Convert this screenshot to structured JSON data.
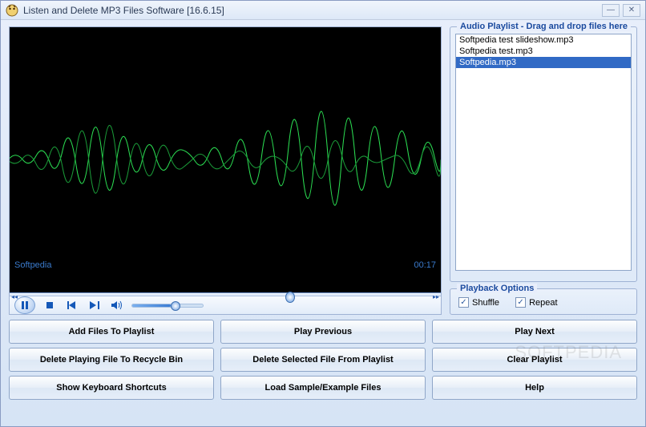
{
  "window": {
    "title": "Listen and Delete MP3 Files Software [16.6.15]"
  },
  "player": {
    "sourceLabel": "Softpedia",
    "timeLabel": "00:17",
    "seekPercent": 64
  },
  "playlist": {
    "groupLabel": "Audio Playlist - Drag and drop files here",
    "items": [
      {
        "name": "Softpedia test slideshow.mp3",
        "selected": false
      },
      {
        "name": "Softpedia test.mp3",
        "selected": false
      },
      {
        "name": "Softpedia.mp3",
        "selected": true
      }
    ]
  },
  "playback": {
    "groupLabel": "Playback Options",
    "shuffle": {
      "label": "Shuffle",
      "checked": true
    },
    "repeat": {
      "label": "Repeat",
      "checked": true
    }
  },
  "buttons": {
    "addFiles": "Add Files To Playlist",
    "playPrev": "Play Previous",
    "playNext": "Play Next",
    "deleteRecycle": "Delete Playing File To Recycle Bin",
    "deleteSelected": "Delete Selected File From Playlist",
    "clearPlaylist": "Clear Playlist",
    "showShortcuts": "Show Keyboard Shortcuts",
    "loadSample": "Load Sample/Example Files",
    "help": "Help"
  },
  "watermark": "SOFTPEDIA"
}
